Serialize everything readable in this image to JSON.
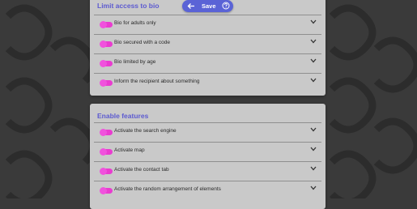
{
  "toolbar": {
    "save_label": "Save"
  },
  "sections": [
    {
      "title": "Limit access to bio",
      "items": [
        {
          "label": "Bio for adults only"
        },
        {
          "label": "Bio secured with a code"
        },
        {
          "label": "Bio limited by age"
        },
        {
          "label": "Inform the recipient about something"
        }
      ]
    },
    {
      "title": "Enable features",
      "items": [
        {
          "label": "Activate the search engine"
        },
        {
          "label": "Activate map"
        },
        {
          "label": "Activate the contact tab"
        },
        {
          "label": "Activate the random arrangement of elements"
        }
      ]
    }
  ],
  "icons": {
    "back": "arrow-left-icon",
    "help": "question-icon",
    "expand": "chevron-down-icon"
  },
  "colors": {
    "accent": "#5c5ad0",
    "toggle_on": "#ea3bd0",
    "card_bg": "#c9c9c9",
    "page_bg": "#3a3a3a"
  }
}
